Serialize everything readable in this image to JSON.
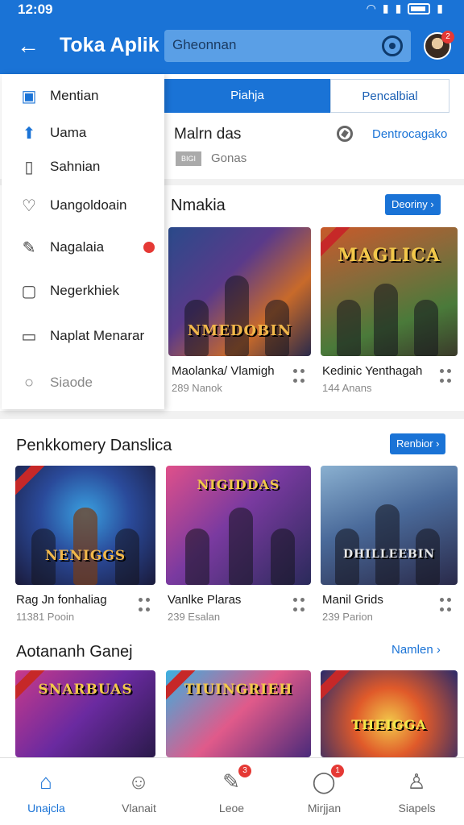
{
  "status": {
    "time": "12:09"
  },
  "header": {
    "title": "Toka Aplik",
    "search_value": "Gheonnan",
    "avatar_badge": "2"
  },
  "drawer": {
    "items": [
      {
        "label": "Mentian",
        "icon": "folder-icon"
      },
      {
        "label": "Uama",
        "icon": "home-icon"
      },
      {
        "label": "Sahnian",
        "icon": "book-icon"
      },
      {
        "label": "Uangoldoain",
        "icon": "heart-icon"
      },
      {
        "label": "Nagalaia",
        "icon": "tag-icon"
      },
      {
        "label": "Negerkhiek",
        "icon": "download-icon"
      },
      {
        "label": "Naplat Menarar",
        "icon": "comment-icon"
      },
      {
        "label": "Siaode",
        "icon": "circle-icon"
      }
    ]
  },
  "tabs": {
    "active": "Piahja",
    "inactive": "Pencalbial"
  },
  "main": {
    "title": "Malrn das",
    "sub_box": "BIGI",
    "sub": "Gonas",
    "link": "Dentrocagako"
  },
  "sections": [
    {
      "title": "Nmakia",
      "action": "Deoriny",
      "cards": [
        {
          "name": "Maolanka/ Vlamigh",
          "meta": "289 Nanok",
          "art": "NMEDOBIN"
        },
        {
          "name": "Kedinic Yenthagah",
          "meta": "144 Anans",
          "art": "MAGLICA"
        }
      ]
    },
    {
      "title": "Penkkomery Danslica",
      "action": "Renbior",
      "cards": [
        {
          "name": "Rag Jn fonhaliag",
          "meta": "11381 Pooin",
          "art": "NENIGGS"
        },
        {
          "name": "Vanlke Plaras",
          "meta": "239 Esalan",
          "art": "NIGIDDAS"
        },
        {
          "name": "Manil Grids",
          "meta": "239 Parion",
          "art": "DHILLEEBIN"
        }
      ]
    },
    {
      "title": "Aotananh Ganej",
      "action": "Namlen",
      "cards": [
        {
          "art": "SNARBUAS"
        },
        {
          "art": "TIUINGRIEH"
        },
        {
          "art": "THEIGGA"
        }
      ]
    }
  ],
  "bottom_nav": [
    {
      "label": "Unajcla",
      "icon": "home-icon",
      "badge": ""
    },
    {
      "label": "Vlanait",
      "icon": "smile-icon",
      "badge": ""
    },
    {
      "label": "Leoe",
      "icon": "pencil-icon",
      "badge": "3"
    },
    {
      "label": "Mirjjan",
      "icon": "chat-icon",
      "badge": "1"
    },
    {
      "label": "Siapels",
      "icon": "user-icon",
      "badge": ""
    }
  ],
  "colors": {
    "primary": "#1a73d6",
    "badge": "#e53935"
  }
}
